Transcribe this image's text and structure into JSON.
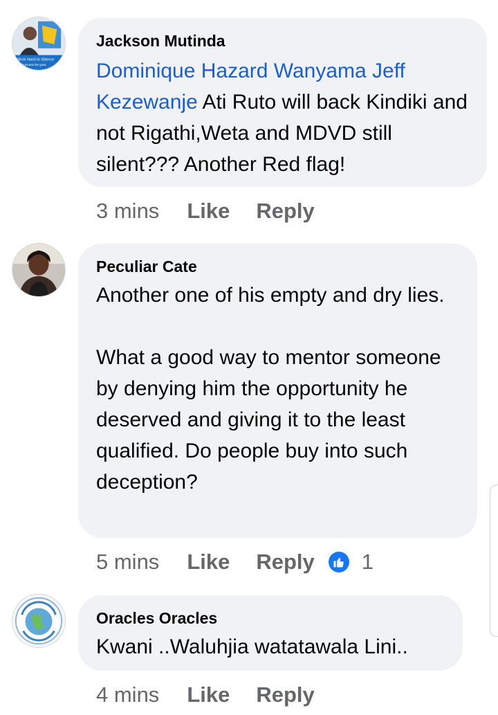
{
  "comments": [
    {
      "author": "Jackson Mutinda",
      "mention": "Dominique Hazard Wanyama Jeff Kezewanje",
      "text": " Ati Ruto will back Kindiki and not Rigathi,Weta and MDVD still silent??? Another Red flag!",
      "time": "3 mins",
      "like_label": "Like",
      "reply_label": "Reply",
      "avatar_text": "Work Hard in Silence"
    },
    {
      "author": "Peculiar Cate",
      "text": "Another one of his empty and dry lies.\n\nWhat a good way to mentor someone by denying him the opportunity he deserved and giving it to the least qualified. Do people buy into such deception?",
      "time": "5 mins",
      "like_label": "Like",
      "reply_label": "Reply",
      "reaction_count": "1"
    },
    {
      "author": "Oracles Oracles",
      "text": "Kwani ..Waluhjia watatawala Lini..",
      "time": "4 mins",
      "like_label": "Like",
      "reply_label": "Reply"
    }
  ],
  "colors": {
    "bubble": "#f0f2f5",
    "mention": "#1b5fcc",
    "meta": "#65676b",
    "like_reaction": "#1877f2"
  }
}
